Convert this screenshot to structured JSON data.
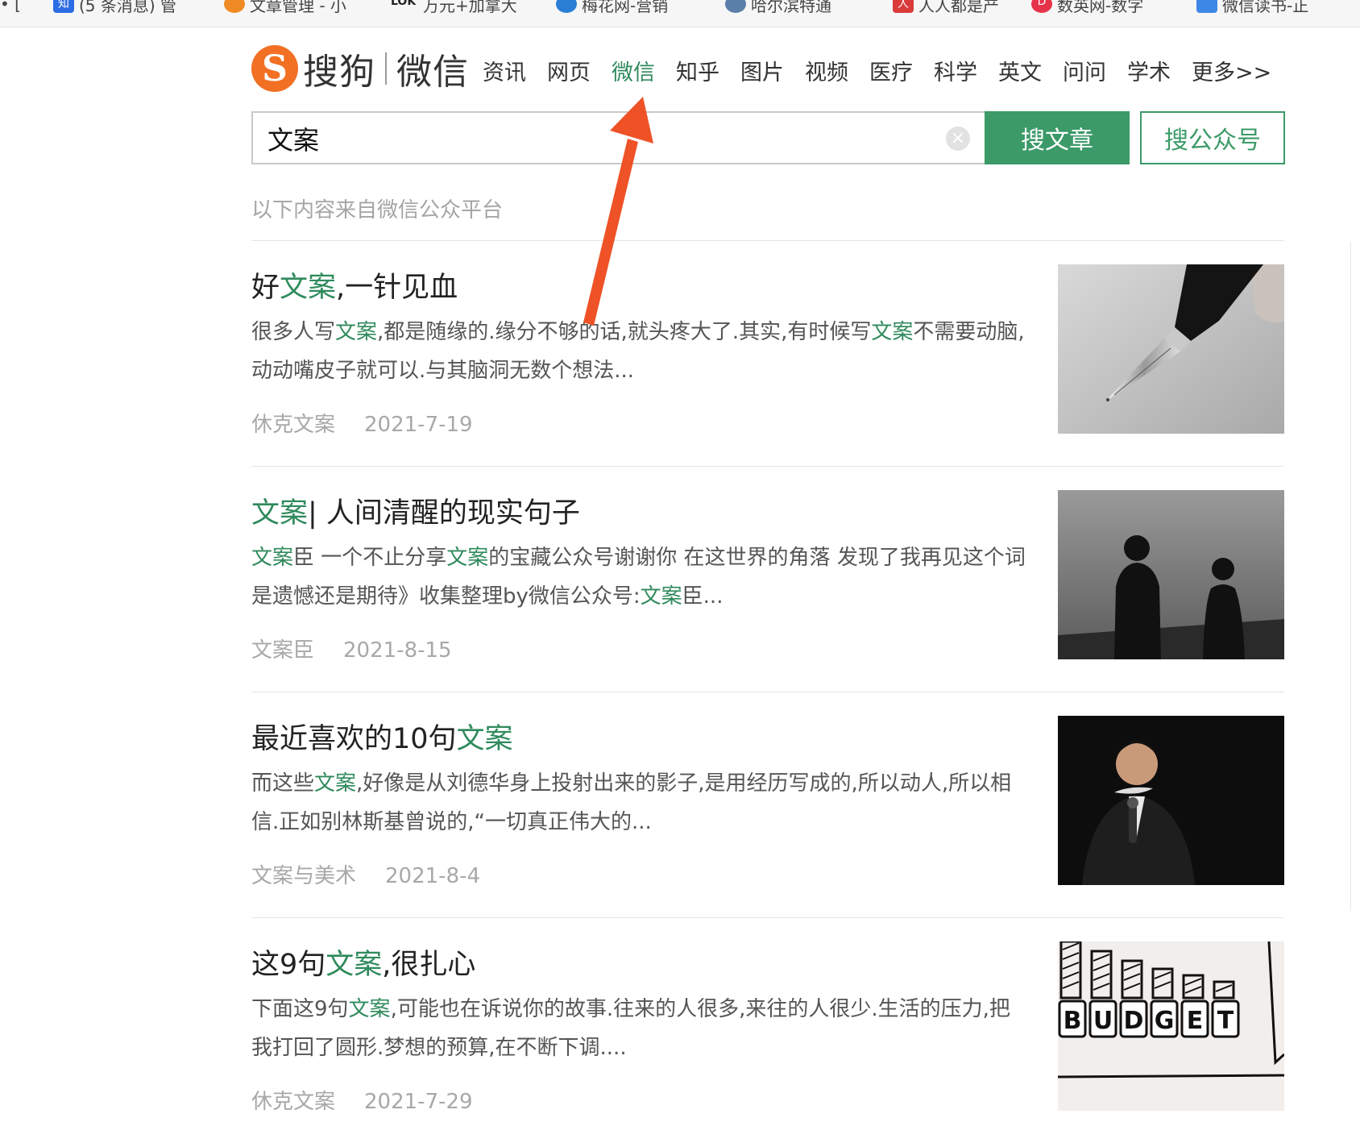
{
  "bookmarks": [
    {
      "label": "• [",
      "color": "#999999"
    },
    {
      "label": "(5 条消息) 管",
      "icon_text": "知",
      "color": "#2d6de4"
    },
    {
      "label": "文章管理 - 小",
      "color": "#f08a24"
    },
    {
      "label": "万元+加拿大",
      "icon_text": "LOK",
      "color": "#222222"
    },
    {
      "label": "梅花网-营销",
      "color": "#2a7fd4"
    },
    {
      "label": "哈尔滨特通",
      "color": "#5a7fa8"
    },
    {
      "label": "人人都是产",
      "icon_text": "人",
      "color": "#d93b3b"
    },
    {
      "label": "数英网-数字",
      "icon_text": "D",
      "color": "#e6334a"
    },
    {
      "label": "微信读书-正",
      "color": "#3d87e6"
    }
  ],
  "header": {
    "logo_letter": "S",
    "logo_sogou": "搜狗",
    "logo_weixin": "微信",
    "nav": [
      {
        "label": "资讯",
        "active": false
      },
      {
        "label": "网页",
        "active": false
      },
      {
        "label": "微信",
        "active": true
      },
      {
        "label": "知乎",
        "active": false
      },
      {
        "label": "图片",
        "active": false
      },
      {
        "label": "视频",
        "active": false
      },
      {
        "label": "医疗",
        "active": false
      },
      {
        "label": "科学",
        "active": false
      },
      {
        "label": "英文",
        "active": false
      },
      {
        "label": "问问",
        "active": false
      },
      {
        "label": "学术",
        "active": false
      },
      {
        "label": "更多>>",
        "active": false
      }
    ]
  },
  "search": {
    "value": "文案",
    "clear": "×",
    "article_button": "搜文章",
    "account_button": "搜公众号"
  },
  "source_note": "以下内容来自微信公众平台",
  "accent_color": "#2f8a5c",
  "results": [
    {
      "title": [
        {
          "t": "好"
        },
        {
          "t": "文案",
          "hl": true
        },
        {
          "t": ",一针见血"
        }
      ],
      "desc": [
        {
          "t": "很多人写"
        },
        {
          "t": "文案",
          "hl": true
        },
        {
          "t": ",都是随缘的.缘分不够的话,就头疼大了.其实,有时候写"
        },
        {
          "t": "文案",
          "hl": true
        },
        {
          "t": "不需要动脑,动动嘴皮子就可以.与其脑洞无数个想法..."
        }
      ],
      "source": "休克文案",
      "date": "2021-7-19",
      "thumb": "fountain-pen"
    },
    {
      "title": [
        {
          "t": "文案",
          "hl": true
        },
        {
          "t": "| 人间清醒的现实句子"
        }
      ],
      "desc": [
        {
          "t": "文案",
          "hl": true
        },
        {
          "t": "臣 一个不止分享"
        },
        {
          "t": "文案",
          "hl": true
        },
        {
          "t": "的宝藏公众号谢谢你 在这世界的角落 发现了我再见这个词是遗憾还是期待》收集整理by微信公众号:"
        },
        {
          "t": "文案",
          "hl": true
        },
        {
          "t": "臣..."
        }
      ],
      "source": "文案臣",
      "date": "2021-8-15",
      "thumb": "silhouettes-sea"
    },
    {
      "title": [
        {
          "t": "最近喜欢的10句"
        },
        {
          "t": "文案",
          "hl": true
        }
      ],
      "desc": [
        {
          "t": "而这些"
        },
        {
          "t": "文案",
          "hl": true
        },
        {
          "t": ",好像是从刘德华身上投射出来的影子,是用经历写成的,所以动人,所以相信.正如别林斯基曾说的,“一切真正伟大的..."
        }
      ],
      "source": "文案与美术",
      "date": "2021-8-4",
      "thumb": "man-microphone"
    },
    {
      "title": [
        {
          "t": "这9句"
        },
        {
          "t": "文案",
          "hl": true
        },
        {
          "t": ",很扎心"
        }
      ],
      "desc": [
        {
          "t": "下面这9句"
        },
        {
          "t": "文案",
          "hl": true
        },
        {
          "t": ",可能也在诉说你的故事.往来的人很多,来往的人很少.生活的压力,把我打回了圆形.梦想的预算,在不断下调...."
        }
      ],
      "source": "休克文案",
      "date": "2021-7-29",
      "thumb": "budget-sketch",
      "thumb_text": [
        "B",
        "U",
        "D",
        "G",
        "E",
        "T"
      ]
    }
  ]
}
